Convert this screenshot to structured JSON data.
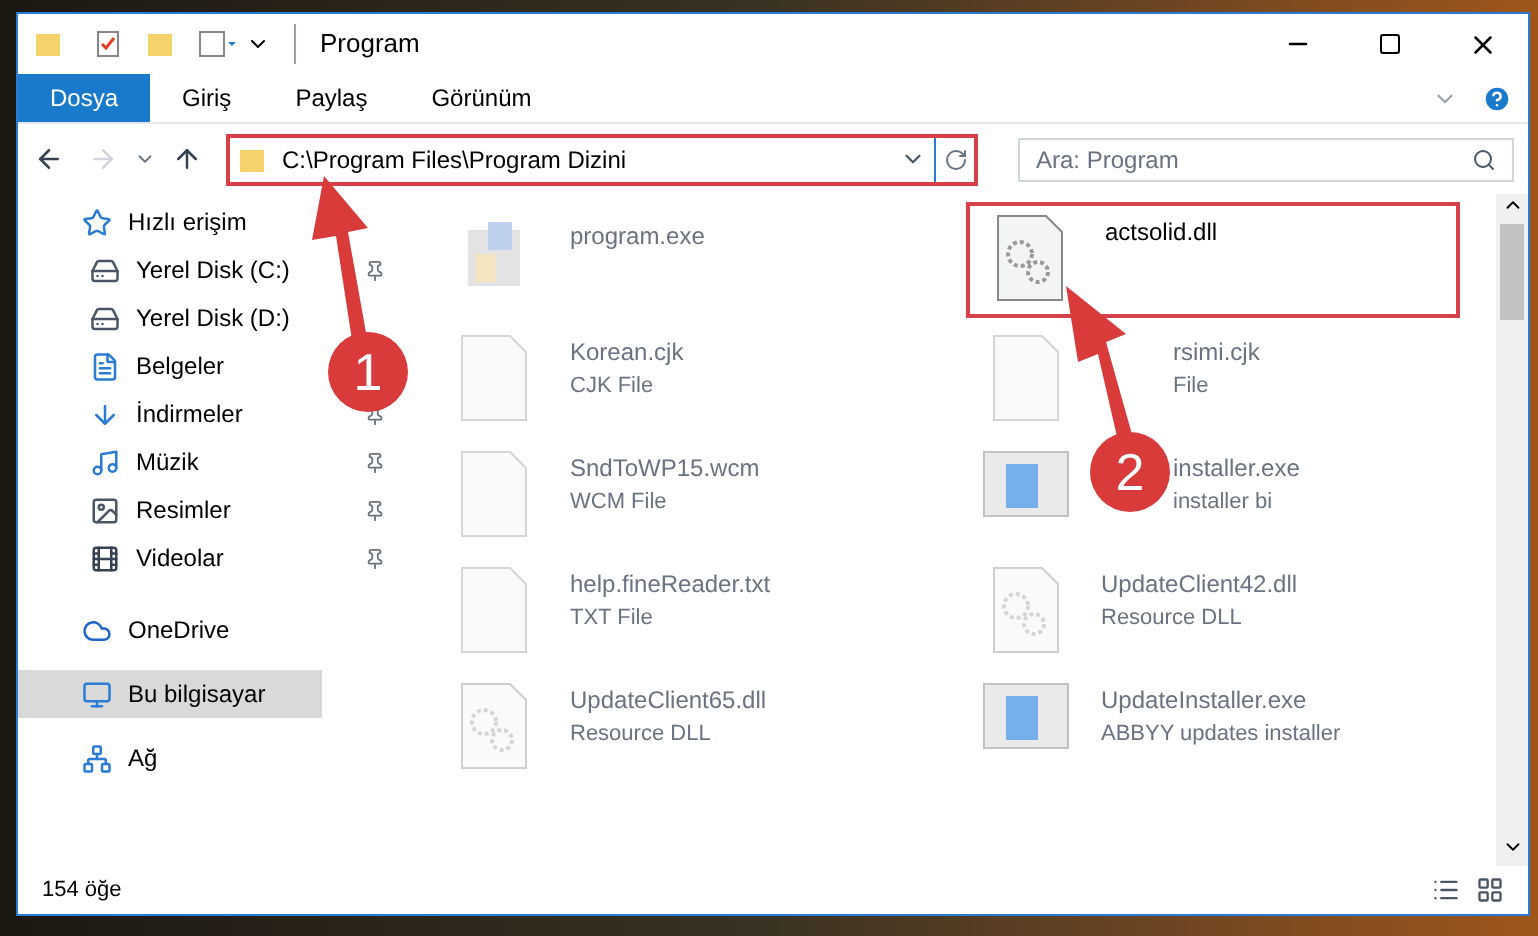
{
  "window": {
    "title": "Program"
  },
  "ribbon_tabs": [
    {
      "label": "Dosya",
      "selected": true
    },
    {
      "label": "Giriş",
      "selected": false
    },
    {
      "label": "Paylaş",
      "selected": false
    },
    {
      "label": "Görünüm",
      "selected": false
    }
  ],
  "address": {
    "path": "C:\\Program Files\\Program Dizini"
  },
  "search": {
    "placeholder": "Ara: Program"
  },
  "sidebar": {
    "items": [
      {
        "label": "Hızlı erişim",
        "kind": "star",
        "selected": false,
        "children": [
          {
            "label": "Yerel Disk (C:)",
            "kind": "drive",
            "pinned": true,
            "selected": false
          },
          {
            "label": "Yerel Disk (D:)",
            "kind": "drive",
            "pinned": false,
            "selected": false
          },
          {
            "label": "Belgeler",
            "kind": "docs",
            "pinned": false,
            "selected": false
          },
          {
            "label": "İndirmeler",
            "kind": "download",
            "pinned": true,
            "selected": false
          },
          {
            "label": "Müzik",
            "kind": "music",
            "pinned": true,
            "selected": false
          },
          {
            "label": "Resimler",
            "kind": "pictures",
            "pinned": true,
            "selected": false
          },
          {
            "label": "Videolar",
            "kind": "videos",
            "pinned": true,
            "selected": false
          }
        ]
      },
      {
        "label": "OneDrive",
        "kind": "cloud",
        "selected": false
      },
      {
        "label": "Bu bilgisayar",
        "kind": "pc",
        "selected": true
      },
      {
        "label": "Ağ",
        "kind": "network",
        "selected": false
      }
    ]
  },
  "files": [
    {
      "name": "program.exe",
      "kind": "app",
      "covered": false,
      "highlighted": false
    },
    {
      "name": "actsolid.dll",
      "kind": "dll",
      "covered": false,
      "highlighted": true
    },
    {
      "name": "Korean.cjk",
      "type": "CJK File",
      "kind": "doc",
      "covered": false,
      "highlighted": false
    },
    {
      "name": "rsimi.cjk",
      "type": "File",
      "kind": "doc",
      "covered": true,
      "highlighted": false
    },
    {
      "name": "SndToWP15.wcm",
      "type": "WCM File",
      "kind": "doc",
      "covered": false,
      "highlighted": false
    },
    {
      "name": "installer.exe",
      "type": "installer bi",
      "kind": "installer",
      "covered": true,
      "highlighted": false
    },
    {
      "name": "help.fineReader.txt",
      "type": "TXT File",
      "kind": "doc",
      "covered": false,
      "highlighted": false
    },
    {
      "name": "UpdateClient42.dll",
      "type": "Resource DLL",
      "kind": "dll",
      "covered": false,
      "highlighted": false
    },
    {
      "name": "UpdateClient65.dll",
      "type": "Resource DLL",
      "kind": "dll",
      "covered": false,
      "highlighted": false
    },
    {
      "name": "UpdateInstaller.exe",
      "type": "ABBYY updates installer",
      "kind": "installer",
      "covered": false,
      "highlighted": false
    }
  ],
  "annotations": [
    {
      "number": "1"
    },
    {
      "number": "2"
    }
  ],
  "status_bar": {
    "count": "154 öğe"
  }
}
